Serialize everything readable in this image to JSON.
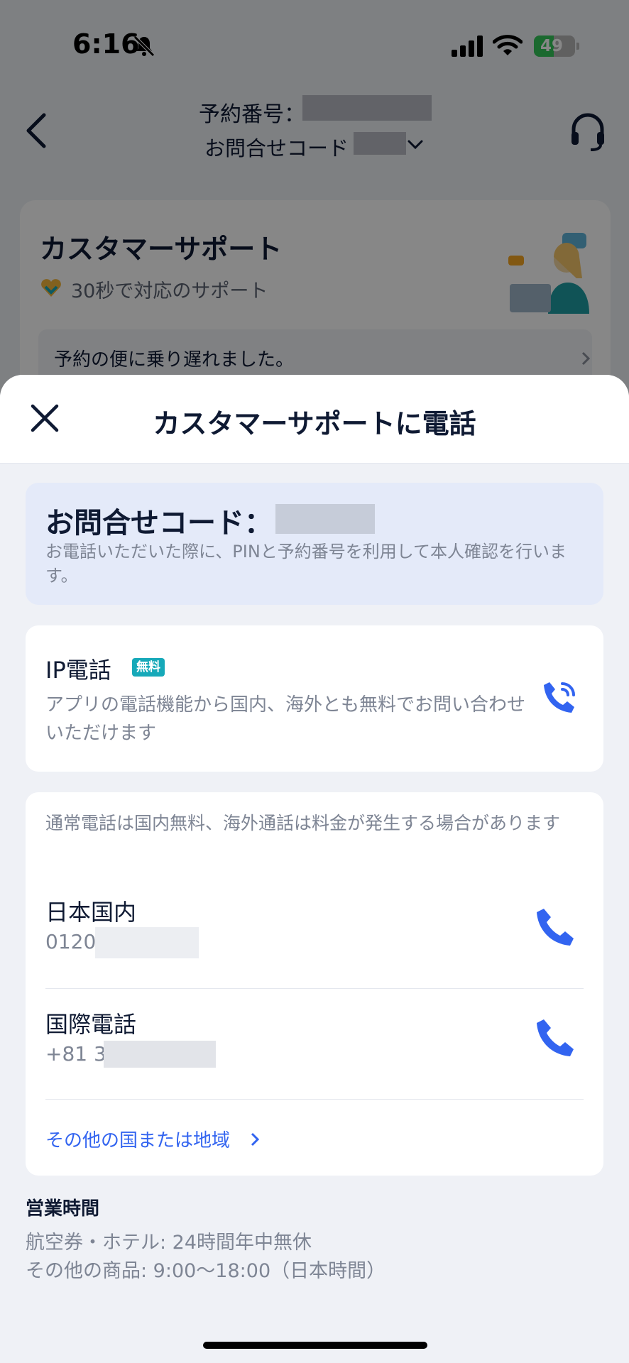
{
  "status_bar": {
    "time": "6:16",
    "battery_level": "49",
    "battery_percent": 49
  },
  "header": {
    "reservation_label": "予約番号：",
    "inquiry_label": "お問合せコード"
  },
  "support_card": {
    "title": "カスタマーサポート",
    "subtitle": "30秒で対応のサポート",
    "issue_label": "予約の便に乗り遅れました。"
  },
  "sheet": {
    "title": "カスタマーサポートに電話",
    "inquiry_code": {
      "title": "お問合せコード：",
      "description": "お電話いただいた際に、PINと予約番号を利用して本人確認を行います。"
    },
    "ip_call": {
      "title": "IP電話",
      "badge": "無料",
      "description": "アプリの電話機能から国内、海外とも無料でお問い合わせいただけます"
    },
    "phone": {
      "note": "通常電話は国内無料、海外通話は料金が発生する場合があります",
      "domestic_label": "日本国内",
      "domestic_number": "0120",
      "international_label": "国際電話",
      "international_number": "+81 3",
      "other_link": "その他の国または地域"
    },
    "hours": {
      "title": "営業時間",
      "line1": "航空券・ホテル: 24時間年中無休",
      "line2": "その他の商品: 9:00～18:00（日本時間）"
    }
  },
  "colors": {
    "accent_blue": "#3264f0",
    "badge_teal": "#16a9b9",
    "sheet_bg": "#eff1f6",
    "code_card_bg": "#e4eaf9"
  }
}
